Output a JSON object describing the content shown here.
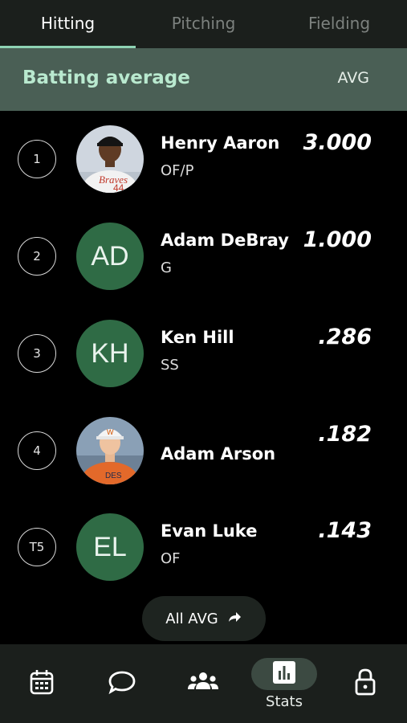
{
  "tabs": [
    {
      "label": "Hitting",
      "active": true
    },
    {
      "label": "Pitching",
      "active": false
    },
    {
      "label": "Fielding",
      "active": false
    }
  ],
  "section": {
    "title": "Batting average",
    "stat": "AVG"
  },
  "players": [
    {
      "rank": "1",
      "name": "Henry Aaron",
      "position": "OF/P",
      "value": "3.000",
      "avatar": "photo"
    },
    {
      "rank": "2",
      "name": "Adam DeBray",
      "position": "G",
      "value": "1.000",
      "initials": "AD"
    },
    {
      "rank": "3",
      "name": "Ken Hill",
      "position": "SS",
      "value": ".286",
      "initials": "KH"
    },
    {
      "rank": "4",
      "name": "Adam Arson",
      "position": "",
      "value": ".182",
      "avatar": "photo"
    },
    {
      "rank": "T5",
      "name": "Evan Luke",
      "position": "OF",
      "value": ".143",
      "initials": "EL"
    }
  ],
  "all_button": {
    "label": "All AVG",
    "icon": "share-arrow-icon"
  },
  "nav": {
    "items": [
      {
        "icon": "calendar-icon"
      },
      {
        "icon": "chat-icon"
      },
      {
        "icon": "team-icon"
      },
      {
        "icon": "stats-icon",
        "label": "Stats",
        "active": true
      },
      {
        "icon": "lock-icon"
      }
    ]
  },
  "colors": {
    "accent": "#8fd3b4",
    "header_bg": "#4a5f55",
    "avatar_bg": "#2f6b45"
  }
}
